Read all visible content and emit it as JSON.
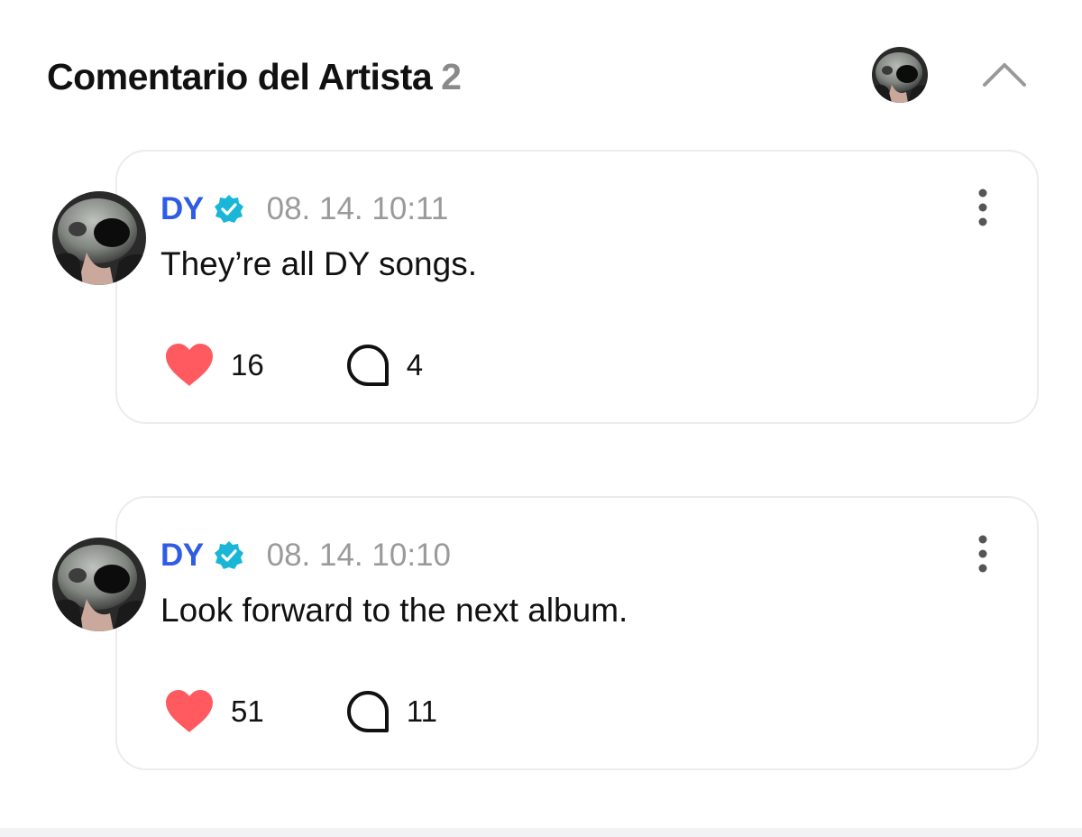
{
  "header": {
    "title": "Comentario del Artista",
    "count": "2",
    "avatar_icon": "user-avatar",
    "collapse_icon": "chevron-up-icon"
  },
  "comments": [
    {
      "author": "DY",
      "verified_icon": "verified-badge-icon",
      "timestamp": "08. 14. 10:11",
      "text": "They’re all DY songs.",
      "likes": "16",
      "replies": "4"
    },
    {
      "author": "DY",
      "verified_icon": "verified-badge-icon",
      "timestamp": "08. 14. 10:10",
      "text": "Look forward to the next album.",
      "likes": "51",
      "replies": "11"
    }
  ],
  "colors": {
    "author": "#2f5ce6",
    "verified": "#19b6d8",
    "like": "#ff5a5f",
    "timestamp": "#9a9a9a",
    "count_muted": "#8a8a8a"
  }
}
